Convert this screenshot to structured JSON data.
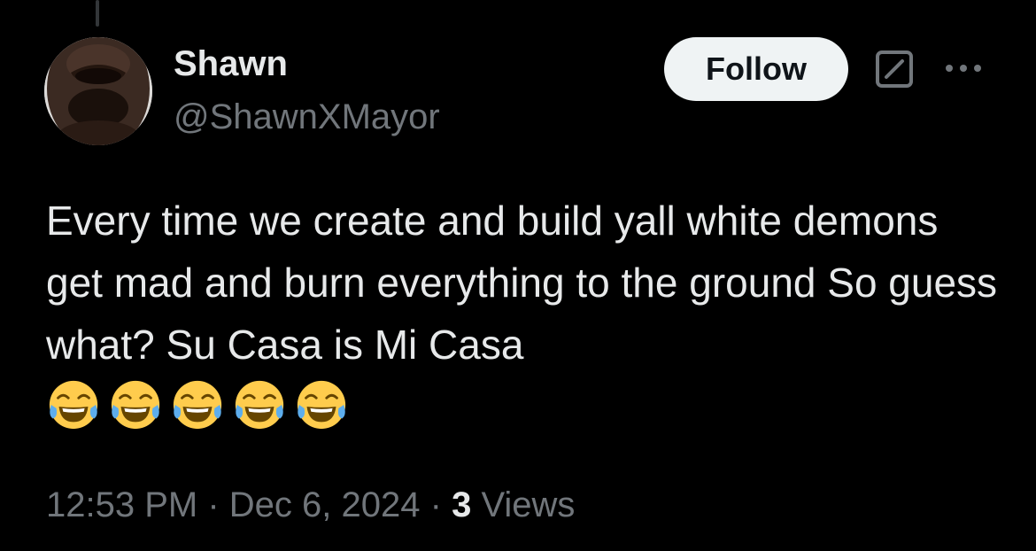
{
  "author": {
    "display_name": "Shawn",
    "handle": "@ShawnXMayor"
  },
  "actions": {
    "follow_label": "Follow",
    "grok_icon": "grok-slash-icon",
    "more_icon": "more-dots-icon"
  },
  "tweet": {
    "text": "Every time we create and build yall white demons get mad and burn everything to the ground So guess what? Su Casa is Mi Casa",
    "emojis": [
      "face-with-tears-of-joy",
      "face-with-tears-of-joy",
      "face-with-tears-of-joy",
      "face-with-tears-of-joy",
      "face-with-tears-of-joy"
    ]
  },
  "meta": {
    "time": "12:53 PM",
    "separator": "·",
    "date": "Dec 6, 2024",
    "views_count": "3",
    "views_label": "Views"
  },
  "colors": {
    "background": "#000000",
    "primary_text": "#e7e9ea",
    "secondary_text": "#71767b",
    "follow_button_bg": "#eff3f4",
    "follow_button_text": "#0f1419"
  }
}
